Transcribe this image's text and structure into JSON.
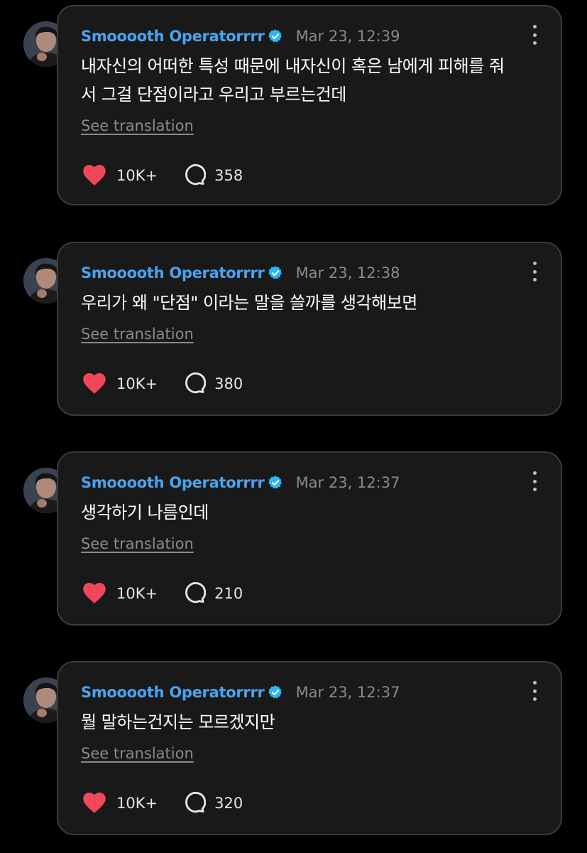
{
  "colors": {
    "username": "#4aa3f0",
    "verified_badge": "#29b6f6",
    "like_heart": "#f0485a",
    "card_background": "#191919",
    "card_border": "#3a3a3a",
    "timestamp": "#8a8a8a"
  },
  "icons": {
    "like": "heart-icon",
    "reply": "speech-bubble-icon",
    "verified": "verified-badge-icon",
    "more": "more-vertical-icon"
  },
  "posts": [
    {
      "username": "Smooooth Operatorrrr",
      "timestamp": "Mar 23, 12:39",
      "lines": [
        "내자신의 어떠한 특성 때문에 내자신이 혹은 남에게 피해를 줘",
        "서 그걸 단점이라고 우리고 부르는건데"
      ],
      "translate_label": "See translation",
      "likes": "10K+",
      "replies": "358"
    },
    {
      "username": "Smooooth Operatorrrr",
      "timestamp": "Mar 23, 12:38",
      "lines": [
        "우리가 왜 \"단점\" 이라는 말을 쓸까를 생각해보면"
      ],
      "translate_label": "See translation",
      "likes": "10K+",
      "replies": "380"
    },
    {
      "username": "Smooooth Operatorrrr",
      "timestamp": "Mar 23, 12:37",
      "lines": [
        "생각하기 나름인데"
      ],
      "translate_label": "See translation",
      "likes": "10K+",
      "replies": "210"
    },
    {
      "username": "Smooooth Operatorrrr",
      "timestamp": "Mar 23, 12:37",
      "lines": [
        "뭘 말하는건지는 모르겠지만"
      ],
      "translate_label": "See translation",
      "likes": "10K+",
      "replies": "320"
    }
  ]
}
